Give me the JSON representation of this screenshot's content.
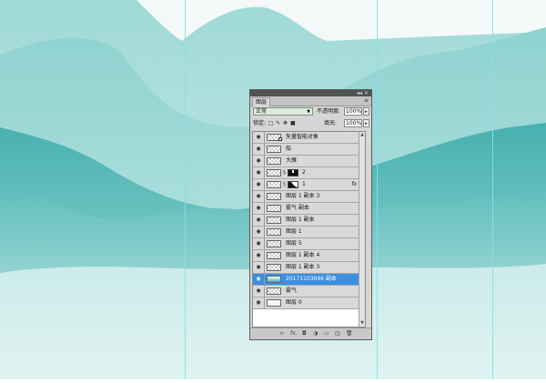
{
  "panel": {
    "tab_label": "图层",
    "titlebar_collapse": "◂◂",
    "titlebar_close": "×",
    "menu_icon": "menu-icon",
    "blend_mode": "正常",
    "opacity_label": "不透明度:",
    "opacity_value": "100%",
    "lock_label": "锁定:",
    "fill_label": "填充:",
    "fill_value": "100%"
  },
  "layers": [
    {
      "name": "矢量智能对象",
      "thumb": "smart",
      "visible": true
    },
    {
      "name": "船",
      "thumb": "checker",
      "visible": true
    },
    {
      "name": "大雁",
      "thumb": "checker",
      "visible": true
    },
    {
      "name": "2",
      "thumb": "checker-mask",
      "visible": true
    },
    {
      "name": "1",
      "thumb": "checker-mask",
      "visible": true,
      "fx": "fx"
    },
    {
      "name": "图层 1 副本 3",
      "thumb": "checker",
      "visible": true
    },
    {
      "name": "雾气 副本",
      "thumb": "checker",
      "visible": true
    },
    {
      "name": "图层 1 副本",
      "thumb": "checker",
      "visible": true
    },
    {
      "name": "图层 1",
      "thumb": "checker",
      "visible": true
    },
    {
      "name": "图层 5",
      "thumb": "checker",
      "visible": true
    },
    {
      "name": "图层 1 副本 4",
      "thumb": "checker",
      "visible": true
    },
    {
      "name": "图层 1 副本 3",
      "thumb": "checker",
      "visible": true
    },
    {
      "name": "20171103046 副本",
      "thumb": "photo",
      "visible": true,
      "selected": true
    },
    {
      "name": "雾气",
      "thumb": "checker",
      "visible": true
    },
    {
      "name": "图层 0",
      "thumb": "plain",
      "visible": true
    }
  ],
  "colors": {
    "selection": "#3a8fe3",
    "guide": "#7fe3ea",
    "mountain_dark": "#3aa9a8",
    "mountain_light": "#a9dedb"
  }
}
